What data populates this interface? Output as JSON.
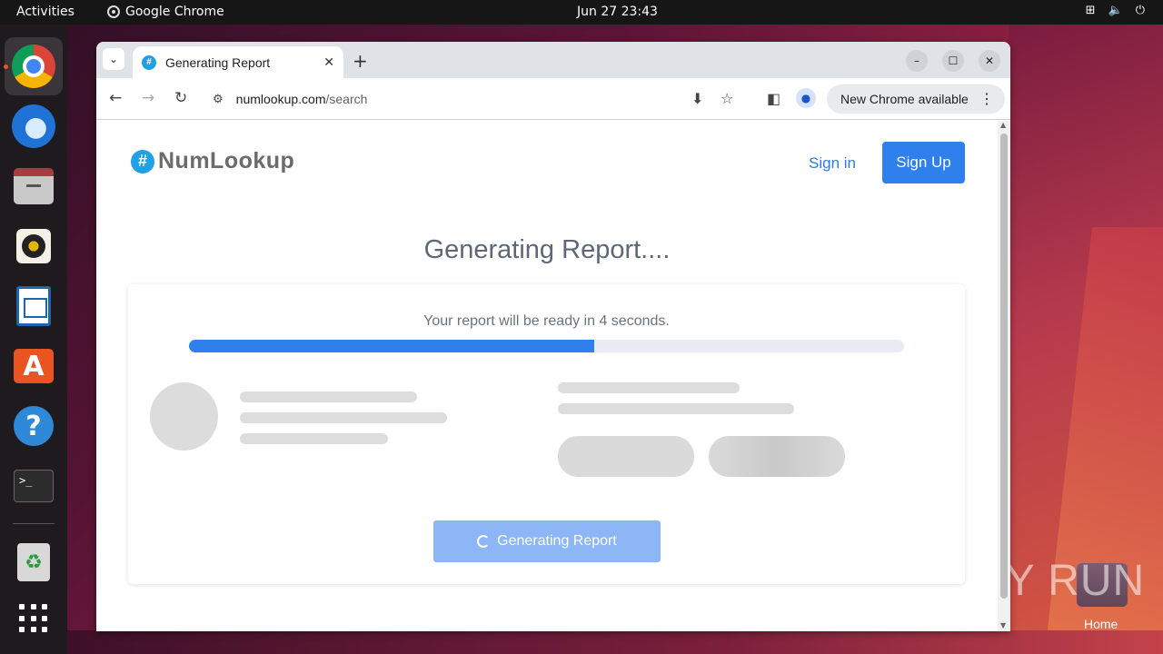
{
  "topbar": {
    "activities": "Activities",
    "app_name": "Google Chrome",
    "clock": "Jun 27  23:43"
  },
  "dock": {
    "items": [
      "chrome-icon",
      "thunderbird-icon",
      "files-icon",
      "rhythmbox-icon",
      "writer-icon",
      "app-center-icon",
      "help-icon",
      "terminal-icon",
      "trash-icon",
      "show-apps-icon"
    ],
    "terminal_glyph": ">_"
  },
  "desktop": {
    "home_label": "Home",
    "watermark": "ANY RUN"
  },
  "browser": {
    "tab_title": "Generating Report",
    "tab_favicon": "#",
    "url_host": "numlookup.com",
    "url_path": "/search",
    "update_label": "New Chrome available"
  },
  "page": {
    "logo_text": "NumLookup",
    "logo_mark": "#",
    "sign_in": "Sign in",
    "sign_up": "Sign Up",
    "heading": "Generating Report....",
    "ready_text": "Your report will be ready in 4 seconds.",
    "progress_fraction": 0.567,
    "generate_button": "Generating Report"
  },
  "colors": {
    "accent": "#2f80ed",
    "button_disabled": "#8db6f7",
    "heading": "#5c6878",
    "skeleton": "#dddddd"
  }
}
